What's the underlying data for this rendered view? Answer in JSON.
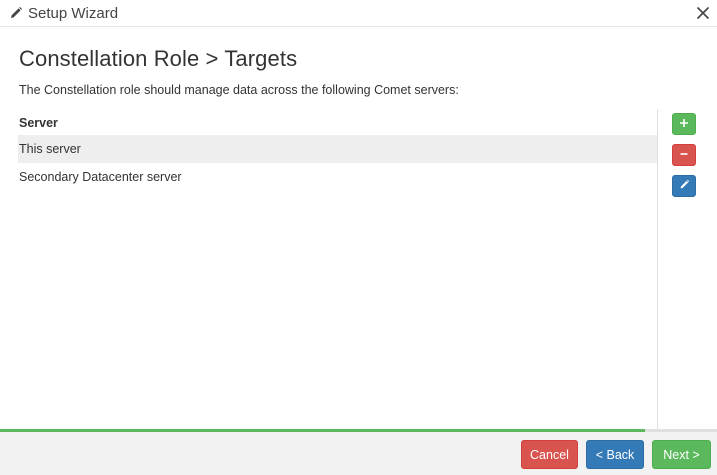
{
  "window": {
    "title": "Setup Wizard",
    "title_icon": "pencil-icon",
    "close_icon": "close-icon"
  },
  "page": {
    "title": "Constellation Role > Targets",
    "description": "The Constellation role should manage data across the following Comet servers:"
  },
  "table": {
    "header": "Server",
    "rows": [
      {
        "label": "This server",
        "selected": true
      },
      {
        "label": "Secondary Datacenter server",
        "selected": false
      }
    ]
  },
  "side_buttons": {
    "add_icon": "plus-icon",
    "remove_icon": "minus-icon",
    "edit_icon": "pencil-icon"
  },
  "progress": {
    "fraction": 0.9
  },
  "footer": {
    "cancel_label": "Cancel",
    "back_label": "< Back",
    "next_label": "Next >"
  },
  "colors": {
    "success": "#5cb85c",
    "danger": "#d9534f",
    "primary": "#337ab7"
  }
}
